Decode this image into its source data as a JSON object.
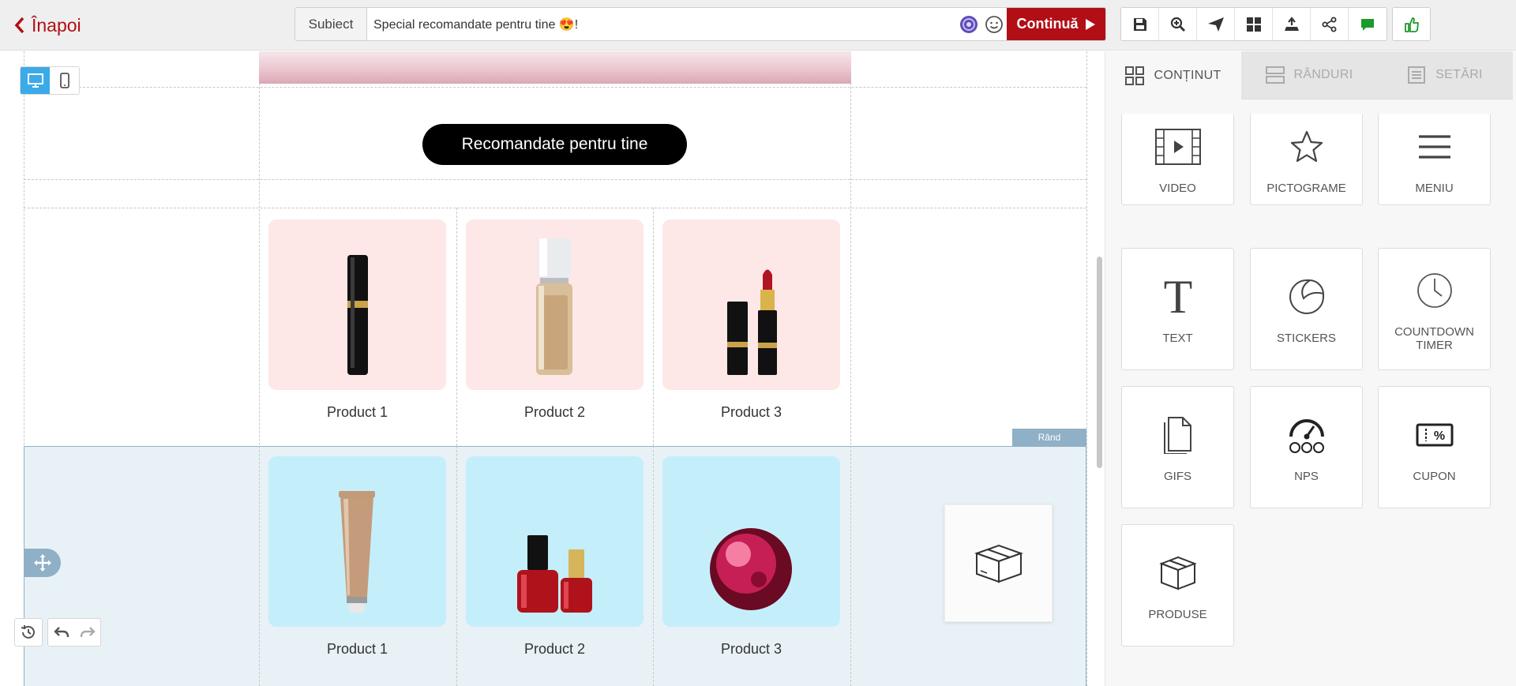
{
  "header": {
    "back_label": "Înapoi",
    "subject_label": "Subiect",
    "subject_value": "Special recomandate pentru tine 😍!",
    "continue_label": "Continuă"
  },
  "toolbar": {
    "icons": [
      "save-icon",
      "zoom-in-icon",
      "send-icon",
      "layout-icon",
      "export-icon",
      "share-icon",
      "comment-icon",
      "approve-icon"
    ]
  },
  "canvas": {
    "button_label": "Recomandate pentru tine",
    "row1": [
      "Product 1",
      "Product 2",
      "Product 3"
    ],
    "row2": [
      "Product 1",
      "Product 2",
      "Product 3"
    ],
    "row_tag": "Rând"
  },
  "panel": {
    "tabs": [
      "CONȚINUT",
      "RÂNDURI",
      "SETĂRI"
    ],
    "tiles": [
      "VIDEO",
      "PICTOGRAME",
      "MENIU",
      "TEXT",
      "STICKERS",
      "COUNTDOWN TIMER",
      "GIFS",
      "NPS",
      "CUPON",
      "PRODUSE"
    ]
  },
  "colors": {
    "brand": "#b20e16",
    "row_highlight": "#e8f1f6",
    "card_pink": "#fde7e7",
    "card_blue": "#c5eefb",
    "device_active": "#3aabe8"
  }
}
